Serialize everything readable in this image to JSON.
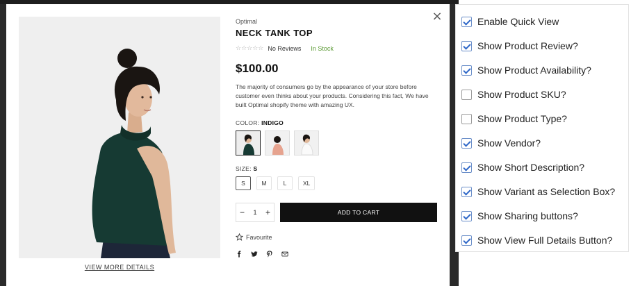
{
  "modal": {
    "close_glyph": "×",
    "vendor": "Optimal",
    "title": "NECK TANK TOP",
    "rating_stars": "☆☆☆☆☆",
    "reviews": "No Reviews",
    "availability": "In Stock",
    "price": "$100.00",
    "description": "The majority of consumers go by the appearance of your store before customer even thinks about your products. Considering this fact, We have built Optimal shopify theme with amazing UX.",
    "color_label": "COLOR:",
    "color_value": "INDIGO",
    "size_label": "SIZE:",
    "size_value": "S",
    "sizes": [
      "S",
      "M",
      "L",
      "XL"
    ],
    "quantity": "1",
    "minus": "−",
    "plus": "+",
    "add_to_cart": "ADD TO CART",
    "favourite": "Favourite",
    "view_more": "VIEW MORE DETAILS",
    "colors": {
      "skin": "#e0b89a",
      "hair": "#1a1512",
      "top": "#163a33",
      "jeans": "#1d2638",
      "stock": "#5b9a34"
    }
  },
  "settings": {
    "options": [
      {
        "label": "Enable Quick View",
        "checked": true
      },
      {
        "label": "Show Product Review?",
        "checked": true
      },
      {
        "label": "Show Product Availability?",
        "checked": true
      },
      {
        "label": "Show Product SKU?",
        "checked": false
      },
      {
        "label": "Show Product Type?",
        "checked": false
      },
      {
        "label": "Show Vendor?",
        "checked": true
      },
      {
        "label": "Show Short Description?",
        "checked": true
      },
      {
        "label": "Show Variant as Selection Box?",
        "checked": true
      },
      {
        "label": "Show Sharing buttons?",
        "checked": true
      },
      {
        "label": "Show View Full Details Button?",
        "checked": true
      }
    ]
  }
}
